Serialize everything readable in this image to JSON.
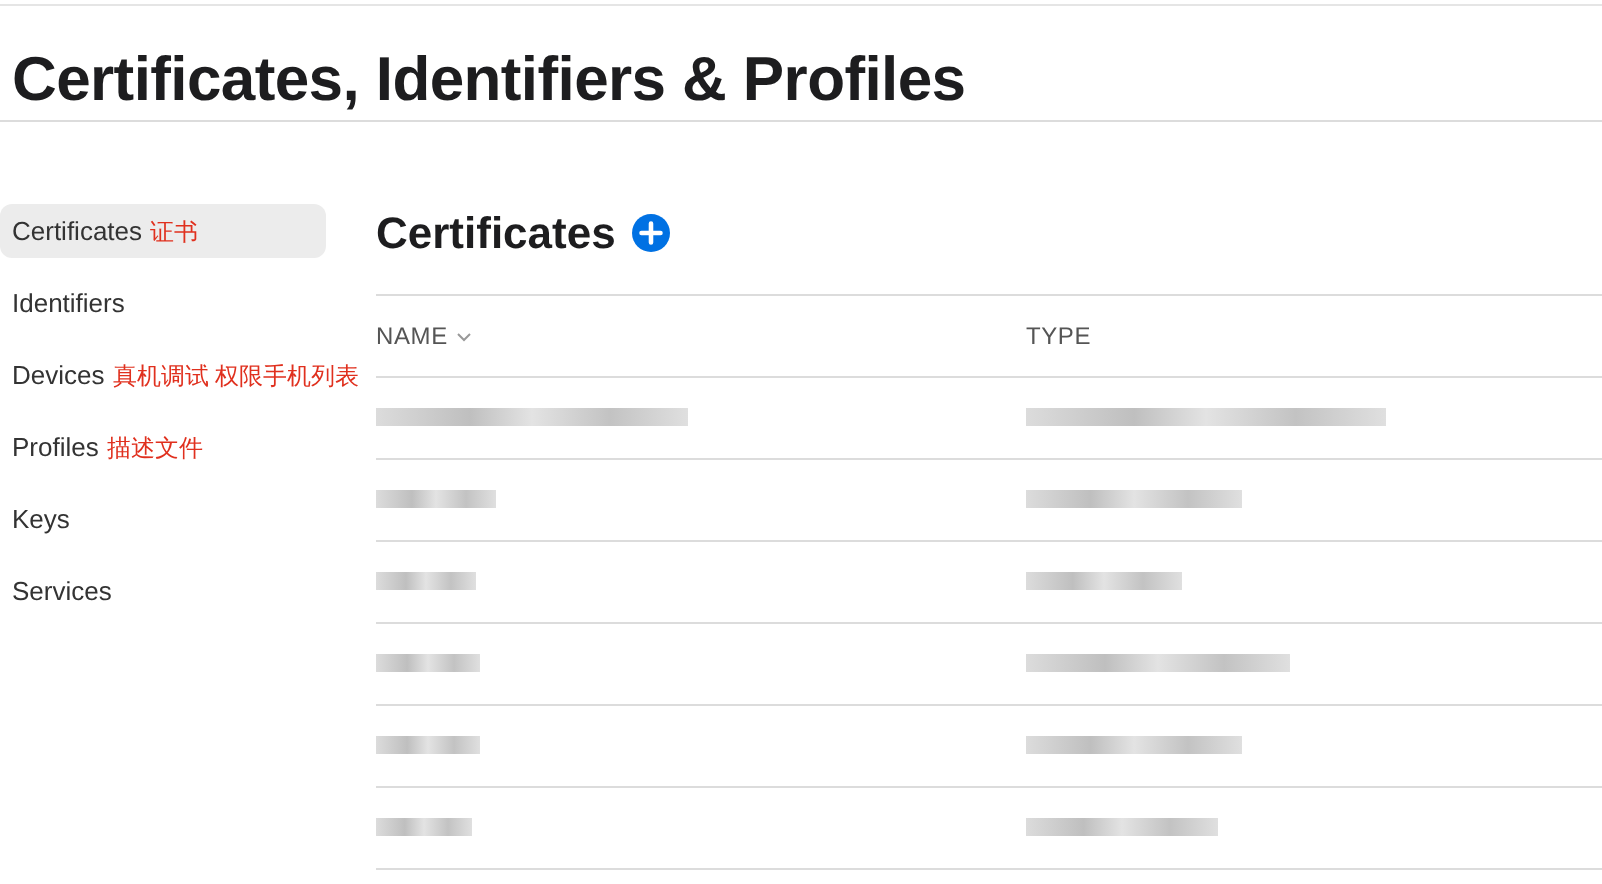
{
  "page_title": "Certificates, Identifiers & Profiles",
  "sidebar": {
    "items": [
      {
        "label": "Certificates",
        "selected": true,
        "annotation": "证书"
      },
      {
        "label": "Identifiers",
        "selected": false
      },
      {
        "label": "Devices",
        "selected": false,
        "annotation": "真机调试 权限手机列表"
      },
      {
        "label": "Profiles",
        "selected": false,
        "annotation": "描述文件"
      },
      {
        "label": "Keys",
        "selected": false
      },
      {
        "label": "Services",
        "selected": false
      }
    ]
  },
  "section": {
    "title": "Certificates"
  },
  "table": {
    "columns": [
      {
        "label": "NAME",
        "sorted": true
      },
      {
        "label": "TYPE",
        "sorted": false
      }
    ],
    "rows": [
      {
        "kind": "redacted"
      },
      {
        "kind": "redacted"
      },
      {
        "kind": "redacted"
      },
      {
        "kind": "redacted"
      },
      {
        "kind": "redacted"
      },
      {
        "kind": "redacted"
      }
    ]
  }
}
